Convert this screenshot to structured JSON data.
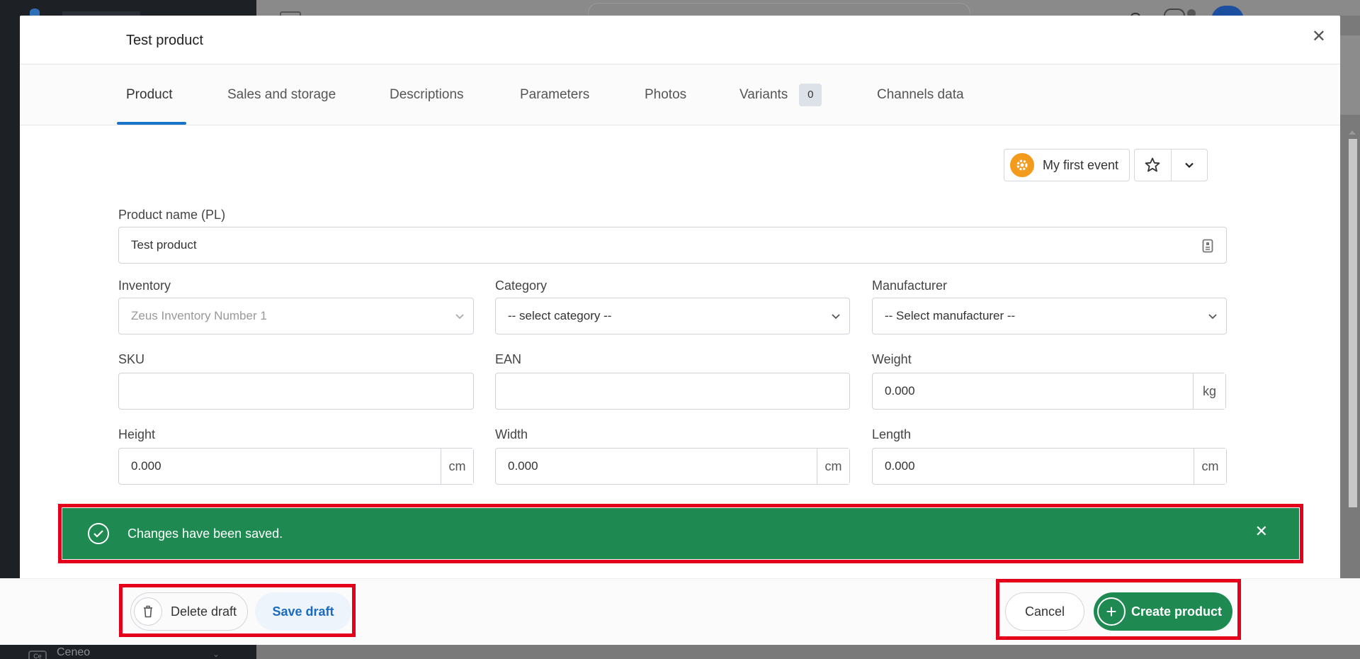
{
  "background": {
    "sidebar_item": "Ceneo",
    "sidebar_item_badge": "Ce"
  },
  "modal": {
    "title": "Test product"
  },
  "tabs": [
    {
      "label": "Product",
      "active": true
    },
    {
      "label": "Sales and storage"
    },
    {
      "label": "Descriptions"
    },
    {
      "label": "Parameters"
    },
    {
      "label": "Photos"
    },
    {
      "label": "Variants",
      "badge": "0"
    },
    {
      "label": "Channels data"
    }
  ],
  "event": {
    "label": "My first event"
  },
  "form": {
    "product_name": {
      "label": "Product name (PL)",
      "value": "Test product"
    },
    "inventory": {
      "label": "Inventory",
      "value": "Zeus Inventory Number 1"
    },
    "category": {
      "label": "Category",
      "value": "-- select category --"
    },
    "manufacturer": {
      "label": "Manufacturer",
      "value": "-- Select manufacturer --"
    },
    "sku": {
      "label": "SKU",
      "value": ""
    },
    "ean": {
      "label": "EAN",
      "value": ""
    },
    "weight": {
      "label": "Weight",
      "value": "0.000",
      "unit": "kg"
    },
    "height": {
      "label": "Height",
      "value": "0.000",
      "unit": "cm"
    },
    "width": {
      "label": "Width",
      "value": "0.000",
      "unit": "cm"
    },
    "length": {
      "label": "Length",
      "value": "0.000",
      "unit": "cm"
    }
  },
  "toast": {
    "message": "Changes have been saved.",
    "color": "#1e8a52"
  },
  "footer": {
    "delete_label": "Delete draft",
    "save_label": "Save draft",
    "cancel_label": "Cancel",
    "create_label": "Create product"
  },
  "colors": {
    "accent": "#1a73c8",
    "success": "#1e8a52",
    "highlight": "#e4001b",
    "event": "#f39b1c"
  }
}
